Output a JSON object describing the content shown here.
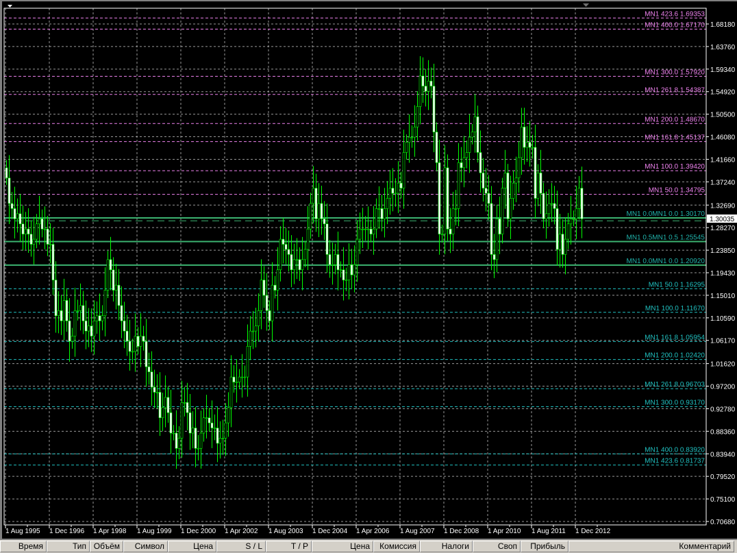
{
  "chart": {
    "symbol_timeframe": "MN1",
    "current_price": "1.30035",
    "price_axis": [
      "1.68180",
      "1.63760",
      "1.59340",
      "1.54920",
      "1.50500",
      "1.46080",
      "1.41660",
      "1.37240",
      "1.32690",
      "1.28270",
      "1.23850",
      "1.19430",
      "1.15010",
      "1.10590",
      "1.06170",
      "1.01620",
      "0.97200",
      "0.92780",
      "0.88360",
      "0.83940",
      "0.79520",
      "0.75100",
      "0.70680"
    ],
    "date_axis": [
      "1 Aug 1995",
      "1 Dec 1996",
      "1 Apr 1998",
      "1 Aug 1999",
      "1 Dec 2000",
      "1 Apr 2002",
      "1 Aug 2003",
      "1 Dec 2004",
      "1 Apr 2006",
      "1 Aug 2007",
      "1 Dec 2008",
      "1 Apr 2010",
      "1 Aug 2011",
      "1 Dec 2012"
    ],
    "first_bar": "Aug 1995",
    "monthly_closes": [
      1.38,
      1.33,
      1.32,
      1.3,
      1.31,
      1.29,
      1.27,
      1.28,
      1.27,
      1.25,
      1.26,
      1.29,
      1.3,
      1.28,
      1.28,
      1.25,
      1.25,
      1.18,
      1.11,
      1.12,
      1.1,
      1.14,
      1.1,
      1.06,
      1.07,
      1.12,
      1.12,
      1.13,
      1.1,
      1.08,
      1.09,
      1.07,
      1.1,
      1.11,
      1.1,
      1.11,
      1.16,
      1.22,
      1.2,
      1.16,
      1.17,
      1.13,
      1.1,
      1.08,
      1.06,
      1.04,
      1.04,
      1.07,
      1.05,
      1.07,
      1.06,
      1.01,
      1.0,
      0.97,
      0.96,
      0.96,
      0.91,
      0.93,
      0.95,
      0.92,
      0.88,
      0.88,
      0.85,
      0.87,
      0.94,
      0.94,
      0.92,
      0.88,
      0.89,
      0.85,
      0.85,
      0.88,
      0.91,
      0.91,
      0.9,
      0.89,
      0.89,
      0.86,
      0.87,
      0.87,
      0.9,
      0.93,
      0.99,
      0.98,
      0.98,
      0.99,
      0.99,
      0.99,
      1.05,
      1.08,
      1.08,
      1.09,
      1.12,
      1.18,
      1.15,
      1.12,
      1.1,
      1.17,
      1.16,
      1.2,
      1.26,
      1.25,
      1.24,
      1.23,
      1.2,
      1.22,
      1.22,
      1.2,
      1.22,
      1.24,
      1.28,
      1.33,
      1.36,
      1.3,
      1.33,
      1.3,
      1.29,
      1.23,
      1.21,
      1.21,
      1.23,
      1.2,
      1.2,
      1.18,
      1.18,
      1.21,
      1.19,
      1.21,
      1.26,
      1.28,
      1.28,
      1.28,
      1.28,
      1.27,
      1.28,
      1.32,
      1.32,
      1.3,
      1.32,
      1.34,
      1.36,
      1.35,
      1.35,
      1.37,
      1.36,
      1.43,
      1.45,
      1.46,
      1.46,
      1.48,
      1.52,
      1.58,
      1.56,
      1.55,
      1.57,
      1.56,
      1.47,
      1.41,
      1.27,
      1.27,
      1.4,
      1.28,
      1.27,
      1.32,
      1.32,
      1.41,
      1.4,
      1.42,
      1.43,
      1.46,
      1.47,
      1.5,
      1.43,
      1.39,
      1.36,
      1.35,
      1.33,
      1.23,
      1.22,
      1.3,
      1.27,
      1.36,
      1.39,
      1.3,
      1.34,
      1.37,
      1.38,
      1.42,
      1.48,
      1.44,
      1.45,
      1.44,
      1.44,
      1.34,
      1.39,
      1.35,
      1.3,
      1.31,
      1.33,
      1.33,
      1.32,
      1.24,
      1.27,
      1.23,
      1.26,
      1.29,
      1.3,
      1.3,
      1.32,
      1.36,
      1.3
    ],
    "fibo_upper": [
      {
        "label": "MN1  423.6 1.69353",
        "value": 1.69353
      },
      {
        "label": "MN1  400.0 1.67170",
        "value": 1.6717
      },
      {
        "label": "MN1  300.0 1.57920",
        "value": 1.5792
      },
      {
        "label": "MN1  261.8 1.54387",
        "value": 1.54387
      },
      {
        "label": "MN1  200.0 1.48670",
        "value": 1.4867
      },
      {
        "label": "MN1  161.8 1.45137",
        "value": 1.45137
      },
      {
        "label": "MN1  100.0 1.39420",
        "value": 1.3942
      },
      {
        "label": "MN1  50.0 1.34795",
        "value": 1.34795
      }
    ],
    "fibo_lower": [
      {
        "label": "MN1  50.0 1.16295",
        "value": 1.16295
      },
      {
        "label": "MN1  100.0 1.11670",
        "value": 1.1167
      },
      {
        "label": "MN1  161.8 1.05954",
        "value": 1.05954
      },
      {
        "label": "MN1  200.0 1.02420",
        "value": 1.0242
      },
      {
        "label": "MN1  261.8 0.96703",
        "value": 0.96703
      },
      {
        "label": "MN1  300.0 0.93170",
        "value": 0.9317
      },
      {
        "label": "MN1  400.0 0.83920",
        "value": 0.8392
      },
      {
        "label": "MN1  423.6 0.81737",
        "value": 0.81737
      }
    ],
    "solid_levels": [
      {
        "label": "MN1  0.0MN1  0.0 1.30170",
        "value": 1.3017
      },
      {
        "label": "MN1  0.5MN1  0.5 1.25545",
        "value": 1.25545
      },
      {
        "label": "MN1  0.0MN1  0.0 1.20920",
        "value": 1.2092
      }
    ],
    "colors": {
      "up": "#00ff00",
      "down": "#ffffff",
      "fibo_upper": "#ee82ee",
      "fibo_lower": "#20c0c0",
      "solid": "#3cb371",
      "grid": "#c0c0c0"
    }
  },
  "terminal": {
    "columns": [
      "Время",
      "Тип",
      "Объём",
      "Символ",
      "Цена",
      "S / L",
      "T / P",
      "Цена",
      "Комиссия",
      "Налоги",
      "Своп",
      "Прибыль",
      "Комментарий"
    ]
  }
}
